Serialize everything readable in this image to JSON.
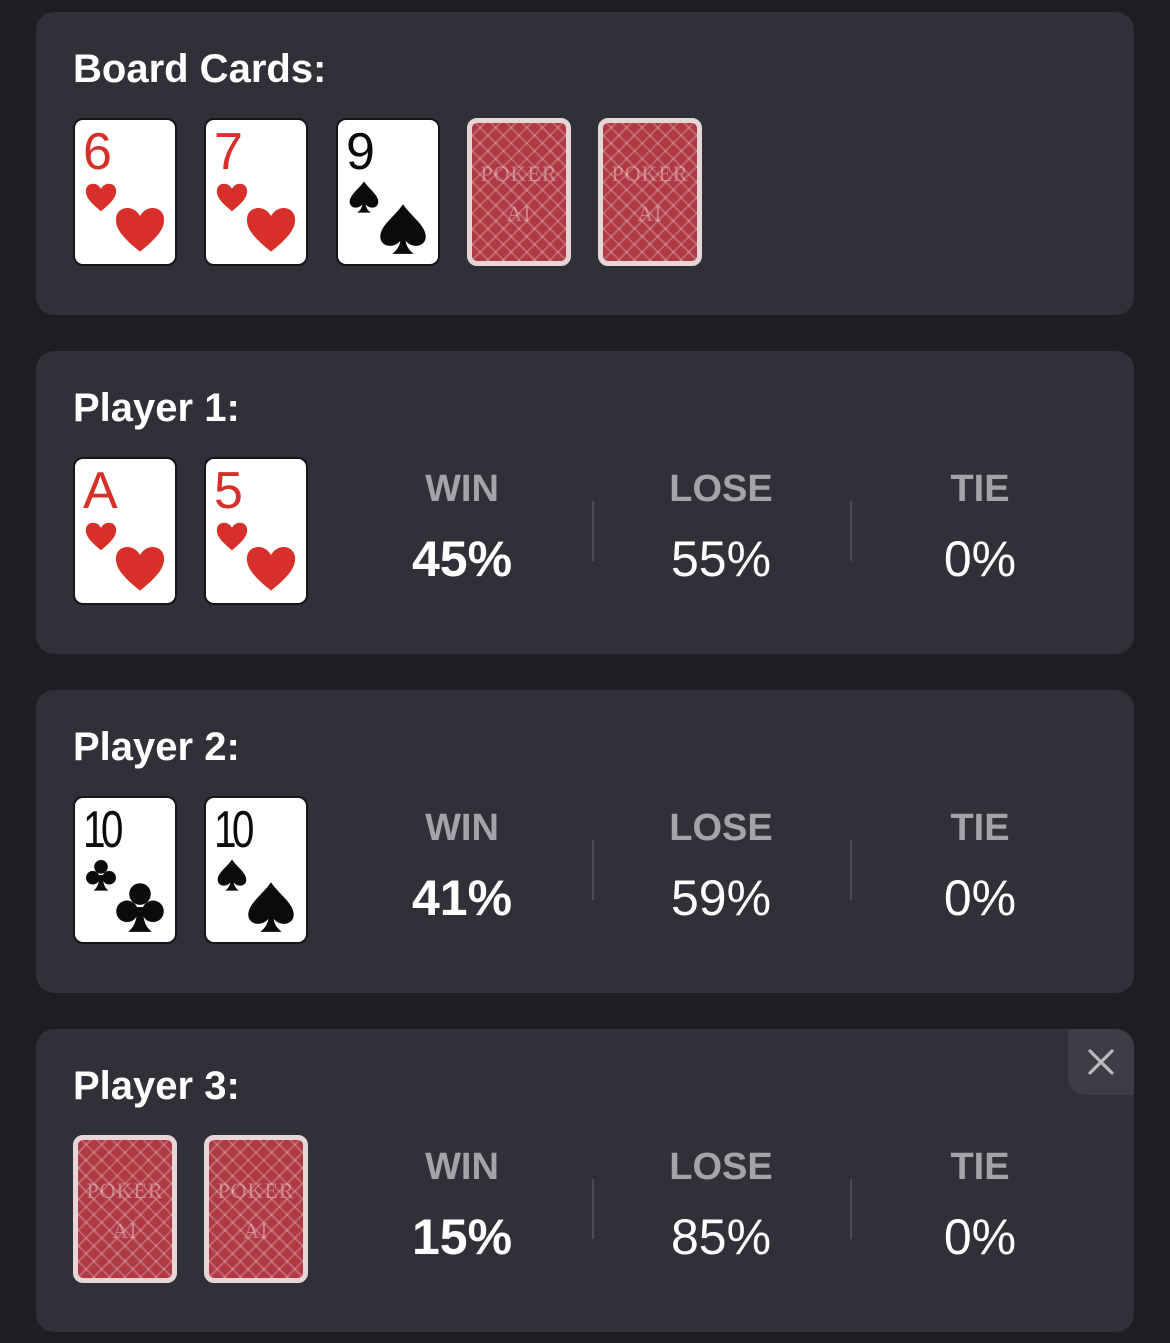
{
  "board": {
    "title": "Board Cards:",
    "cards": [
      {
        "rank": "6",
        "suit": "hearts",
        "color": "#d7302b"
      },
      {
        "rank": "7",
        "suit": "hearts",
        "color": "#d7302b"
      },
      {
        "rank": "9",
        "suit": "spades",
        "color": "#0b0b0b"
      },
      {
        "back_line1": "POKER",
        "back_line2": "AI"
      },
      {
        "back_line1": "POKER",
        "back_line2": "AI"
      }
    ]
  },
  "players": [
    {
      "title": "Player 1:",
      "cards": [
        {
          "rank": "A",
          "suit": "hearts"
        },
        {
          "rank": "5",
          "suit": "hearts"
        }
      ],
      "stats": {
        "win_label": "WIN",
        "win": "45%",
        "lose_label": "LOSE",
        "lose": "55%",
        "tie_label": "TIE",
        "tie": "0%"
      }
    },
    {
      "title": "Player 2:",
      "cards": [
        {
          "rank": "10",
          "suit": "clubs"
        },
        {
          "rank": "10",
          "suit": "spades"
        }
      ],
      "stats": {
        "win_label": "WIN",
        "win": "41%",
        "lose_label": "LOSE",
        "lose": "59%",
        "tie_label": "TIE",
        "tie": "0%"
      }
    },
    {
      "title": "Player 3:",
      "cards": [
        {
          "back_line1": "POKER",
          "back_line2": "AI"
        },
        {
          "back_line1": "POKER",
          "back_line2": "AI"
        }
      ],
      "stats": {
        "win_label": "WIN",
        "win": "15%",
        "lose_label": "LOSE",
        "lose": "85%",
        "tie_label": "TIE",
        "tie": "0%"
      }
    }
  ],
  "colors": {
    "background": "#1d1e23",
    "panel": "#2f3038",
    "red_suit": "#d7302b",
    "black_suit": "#0b0b0b",
    "card_back": "#b03a44",
    "label_gray": "#a3a4a8"
  },
  "icons": {
    "close": "close-icon"
  }
}
